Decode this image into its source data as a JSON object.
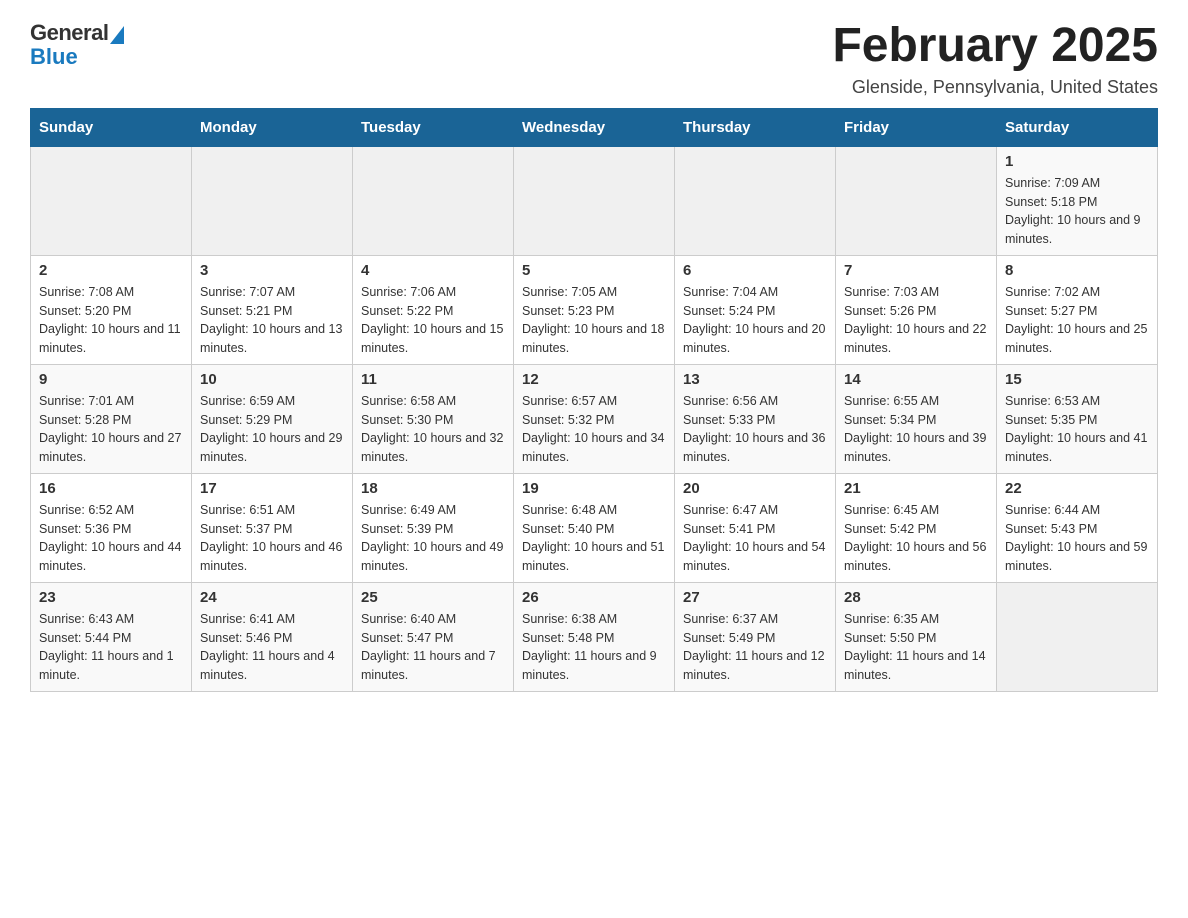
{
  "logo": {
    "general": "General",
    "blue": "Blue"
  },
  "title": "February 2025",
  "location": "Glenside, Pennsylvania, United States",
  "days_of_week": [
    "Sunday",
    "Monday",
    "Tuesday",
    "Wednesday",
    "Thursday",
    "Friday",
    "Saturday"
  ],
  "weeks": [
    [
      {
        "day": "",
        "info": ""
      },
      {
        "day": "",
        "info": ""
      },
      {
        "day": "",
        "info": ""
      },
      {
        "day": "",
        "info": ""
      },
      {
        "day": "",
        "info": ""
      },
      {
        "day": "",
        "info": ""
      },
      {
        "day": "1",
        "info": "Sunrise: 7:09 AM\nSunset: 5:18 PM\nDaylight: 10 hours and 9 minutes."
      }
    ],
    [
      {
        "day": "2",
        "info": "Sunrise: 7:08 AM\nSunset: 5:20 PM\nDaylight: 10 hours and 11 minutes."
      },
      {
        "day": "3",
        "info": "Sunrise: 7:07 AM\nSunset: 5:21 PM\nDaylight: 10 hours and 13 minutes."
      },
      {
        "day": "4",
        "info": "Sunrise: 7:06 AM\nSunset: 5:22 PM\nDaylight: 10 hours and 15 minutes."
      },
      {
        "day": "5",
        "info": "Sunrise: 7:05 AM\nSunset: 5:23 PM\nDaylight: 10 hours and 18 minutes."
      },
      {
        "day": "6",
        "info": "Sunrise: 7:04 AM\nSunset: 5:24 PM\nDaylight: 10 hours and 20 minutes."
      },
      {
        "day": "7",
        "info": "Sunrise: 7:03 AM\nSunset: 5:26 PM\nDaylight: 10 hours and 22 minutes."
      },
      {
        "day": "8",
        "info": "Sunrise: 7:02 AM\nSunset: 5:27 PM\nDaylight: 10 hours and 25 minutes."
      }
    ],
    [
      {
        "day": "9",
        "info": "Sunrise: 7:01 AM\nSunset: 5:28 PM\nDaylight: 10 hours and 27 minutes."
      },
      {
        "day": "10",
        "info": "Sunrise: 6:59 AM\nSunset: 5:29 PM\nDaylight: 10 hours and 29 minutes."
      },
      {
        "day": "11",
        "info": "Sunrise: 6:58 AM\nSunset: 5:30 PM\nDaylight: 10 hours and 32 minutes."
      },
      {
        "day": "12",
        "info": "Sunrise: 6:57 AM\nSunset: 5:32 PM\nDaylight: 10 hours and 34 minutes."
      },
      {
        "day": "13",
        "info": "Sunrise: 6:56 AM\nSunset: 5:33 PM\nDaylight: 10 hours and 36 minutes."
      },
      {
        "day": "14",
        "info": "Sunrise: 6:55 AM\nSunset: 5:34 PM\nDaylight: 10 hours and 39 minutes."
      },
      {
        "day": "15",
        "info": "Sunrise: 6:53 AM\nSunset: 5:35 PM\nDaylight: 10 hours and 41 minutes."
      }
    ],
    [
      {
        "day": "16",
        "info": "Sunrise: 6:52 AM\nSunset: 5:36 PM\nDaylight: 10 hours and 44 minutes."
      },
      {
        "day": "17",
        "info": "Sunrise: 6:51 AM\nSunset: 5:37 PM\nDaylight: 10 hours and 46 minutes."
      },
      {
        "day": "18",
        "info": "Sunrise: 6:49 AM\nSunset: 5:39 PM\nDaylight: 10 hours and 49 minutes."
      },
      {
        "day": "19",
        "info": "Sunrise: 6:48 AM\nSunset: 5:40 PM\nDaylight: 10 hours and 51 minutes."
      },
      {
        "day": "20",
        "info": "Sunrise: 6:47 AM\nSunset: 5:41 PM\nDaylight: 10 hours and 54 minutes."
      },
      {
        "day": "21",
        "info": "Sunrise: 6:45 AM\nSunset: 5:42 PM\nDaylight: 10 hours and 56 minutes."
      },
      {
        "day": "22",
        "info": "Sunrise: 6:44 AM\nSunset: 5:43 PM\nDaylight: 10 hours and 59 minutes."
      }
    ],
    [
      {
        "day": "23",
        "info": "Sunrise: 6:43 AM\nSunset: 5:44 PM\nDaylight: 11 hours and 1 minute."
      },
      {
        "day": "24",
        "info": "Sunrise: 6:41 AM\nSunset: 5:46 PM\nDaylight: 11 hours and 4 minutes."
      },
      {
        "day": "25",
        "info": "Sunrise: 6:40 AM\nSunset: 5:47 PM\nDaylight: 11 hours and 7 minutes."
      },
      {
        "day": "26",
        "info": "Sunrise: 6:38 AM\nSunset: 5:48 PM\nDaylight: 11 hours and 9 minutes."
      },
      {
        "day": "27",
        "info": "Sunrise: 6:37 AM\nSunset: 5:49 PM\nDaylight: 11 hours and 12 minutes."
      },
      {
        "day": "28",
        "info": "Sunrise: 6:35 AM\nSunset: 5:50 PM\nDaylight: 11 hours and 14 minutes."
      },
      {
        "day": "",
        "info": ""
      }
    ]
  ]
}
